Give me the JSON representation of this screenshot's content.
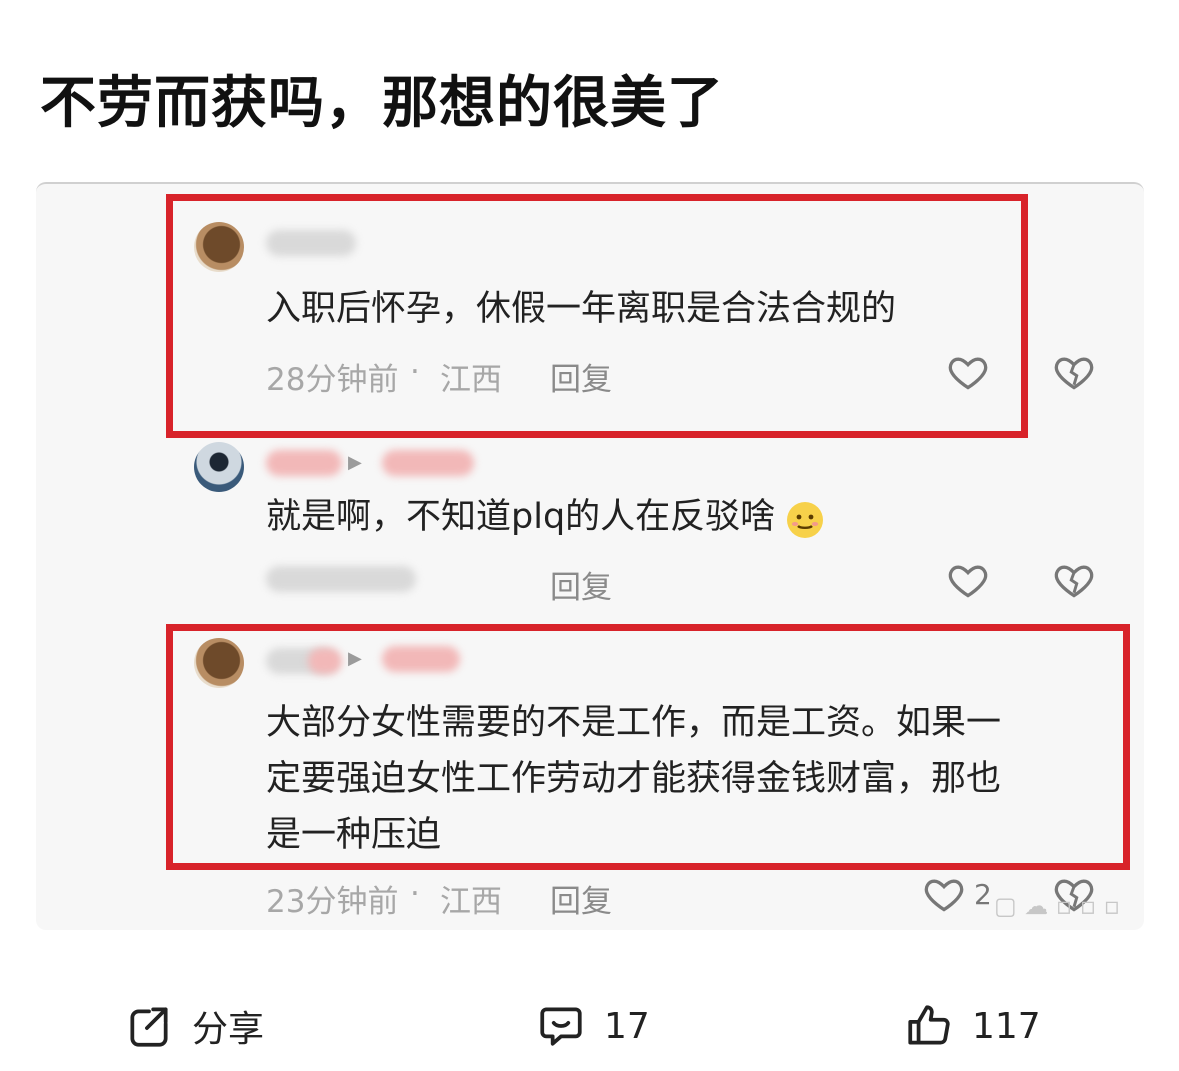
{
  "post": {
    "title": "不劳而获吗，那想的很美了"
  },
  "comments": [
    {
      "text": "入职后怀孕，休假一年离职是合法合规的",
      "time": "28分钟前",
      "location": "江西",
      "reply_label": "回复"
    },
    {
      "text": "就是啊，不知道plq的人在反驳啥",
      "time": "",
      "location": "",
      "reply_label": "回复"
    },
    {
      "text_lines": [
        "大部分女性需要的不是工作，而是工资。如果一",
        "定要强迫女性工作劳动才能获得金钱财富，那也",
        "是一种压迫"
      ],
      "time": "23分钟前",
      "location": "江西",
      "reply_label": "回复",
      "like_count": "2"
    }
  ],
  "meta_separator": "·",
  "bottom_bar": {
    "share_label": "分享",
    "comment_count": "17",
    "like_count": "117"
  },
  "colors": {
    "highlight_box": "#d8232a",
    "meta_text": "#a7a7a7"
  }
}
